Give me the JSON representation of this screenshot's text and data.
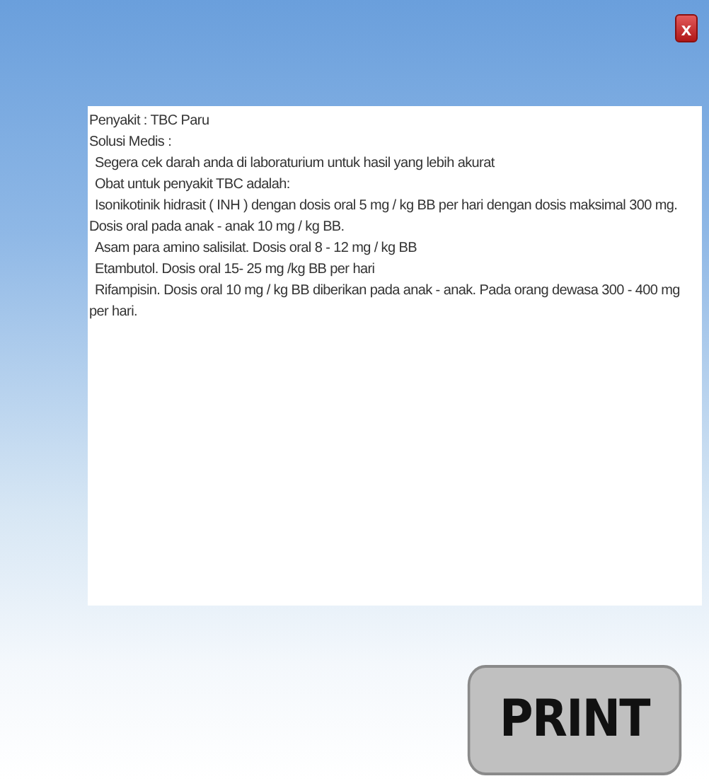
{
  "close_button": {
    "label": "x"
  },
  "result_lines": [
    {
      "kind": "heading",
      "text": "Penyakit : TBC Paru"
    },
    {
      "kind": "heading",
      "text": "Solusi Medis :"
    },
    {
      "kind": "item",
      "text": "Segera cek darah anda di laboraturium untuk hasil yang lebih akurat"
    },
    {
      "kind": "item",
      "text": "Obat untuk penyakit TBC adalah:"
    },
    {
      "kind": "item",
      "text": "Isonikotinik hidrasit ( INH ) dengan dosis oral 5 mg / kg BB per hari dengan dosis maksimal 300 mg. Dosis oral pada anak - anak 10 mg / kg BB."
    },
    {
      "kind": "item",
      "text": "Asam para amino salisilat. Dosis oral 8 - 12 mg / kg BB"
    },
    {
      "kind": "item",
      "text": "Etambutol. Dosis oral 15- 25 mg /kg BB per hari"
    },
    {
      "kind": "item",
      "text": "Rifampisin. Dosis oral 10 mg / kg BB diberikan pada anak - anak. Pada orang dewasa 300 - 400 mg per hari."
    }
  ],
  "print_button": {
    "label": "PRINT"
  }
}
